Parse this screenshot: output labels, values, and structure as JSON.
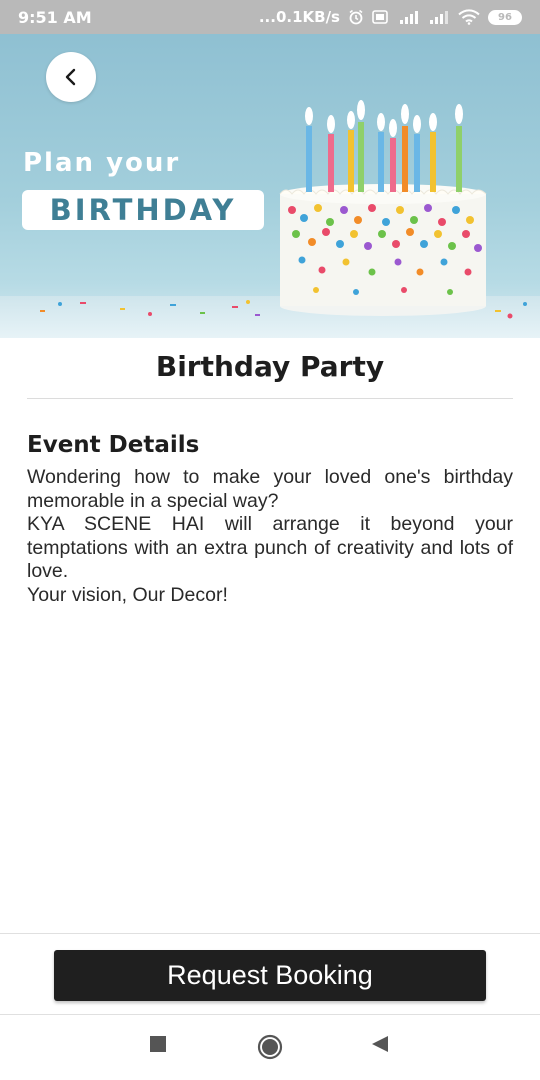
{
  "status_bar": {
    "time": "9:51 AM",
    "network_speed": "...0.1KB/s",
    "battery": "96",
    "icons": [
      "alarm-icon",
      "volte-icon",
      "signal-4g-icon",
      "signal-icon",
      "wifi-icon",
      "battery-icon"
    ]
  },
  "banner": {
    "plan_text": "Plan your",
    "birthday_text": "BIRTHDAY",
    "back_icon": "back-arrow-icon"
  },
  "page": {
    "title": "Birthday Party"
  },
  "event_details": {
    "heading": "Event Details",
    "paragraphs": [
      "Wondering how to make your loved one's birthday memorable in a special way?",
      "KYA SCENE HAI will arrange it beyond your temptations with an extra punch of creativity and lots of love.",
      "Your vision, Our Decor!"
    ]
  },
  "booking": {
    "button_label": "Request Booking"
  },
  "nav_bar": {
    "icons": [
      "recents-icon",
      "home-icon",
      "back-icon"
    ]
  },
  "colors": {
    "status_bar": "#b9b9b9",
    "banner_blue": "#8fc0d2",
    "birthday_text": "#3f7f95",
    "button": "#1f1f1f"
  }
}
